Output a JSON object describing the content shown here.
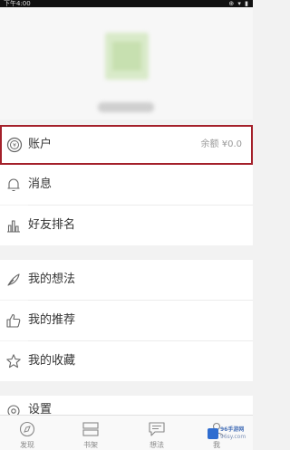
{
  "statusbar": {
    "time": "下午4:00",
    "system_icons": "⊕ ▾ ▮"
  },
  "profile": {
    "nickname": ""
  },
  "menu": {
    "account": {
      "label": "账户",
      "value": "余额 ¥0.0"
    },
    "messages": {
      "label": "消息"
    },
    "friend_ranking": {
      "label": "好友排名"
    },
    "my_thoughts": {
      "label": "我的想法"
    },
    "my_recommendations": {
      "label": "我的推荐"
    },
    "my_favorites": {
      "label": "我的收藏"
    },
    "settings": {
      "label": "设置"
    }
  },
  "tabbar": {
    "tabs": [
      {
        "label": "发现",
        "icon": "compass-icon"
      },
      {
        "label": "书架",
        "icon": "bookshelf-icon"
      },
      {
        "label": "想法",
        "icon": "chat-icon"
      },
      {
        "label": "我",
        "icon": "user-icon"
      }
    ]
  },
  "watermark": {
    "title": "96手游网",
    "url": "96sy.com"
  },
  "colors": {
    "highlight_border": "#a4202a",
    "background": "#f2f2f2"
  }
}
